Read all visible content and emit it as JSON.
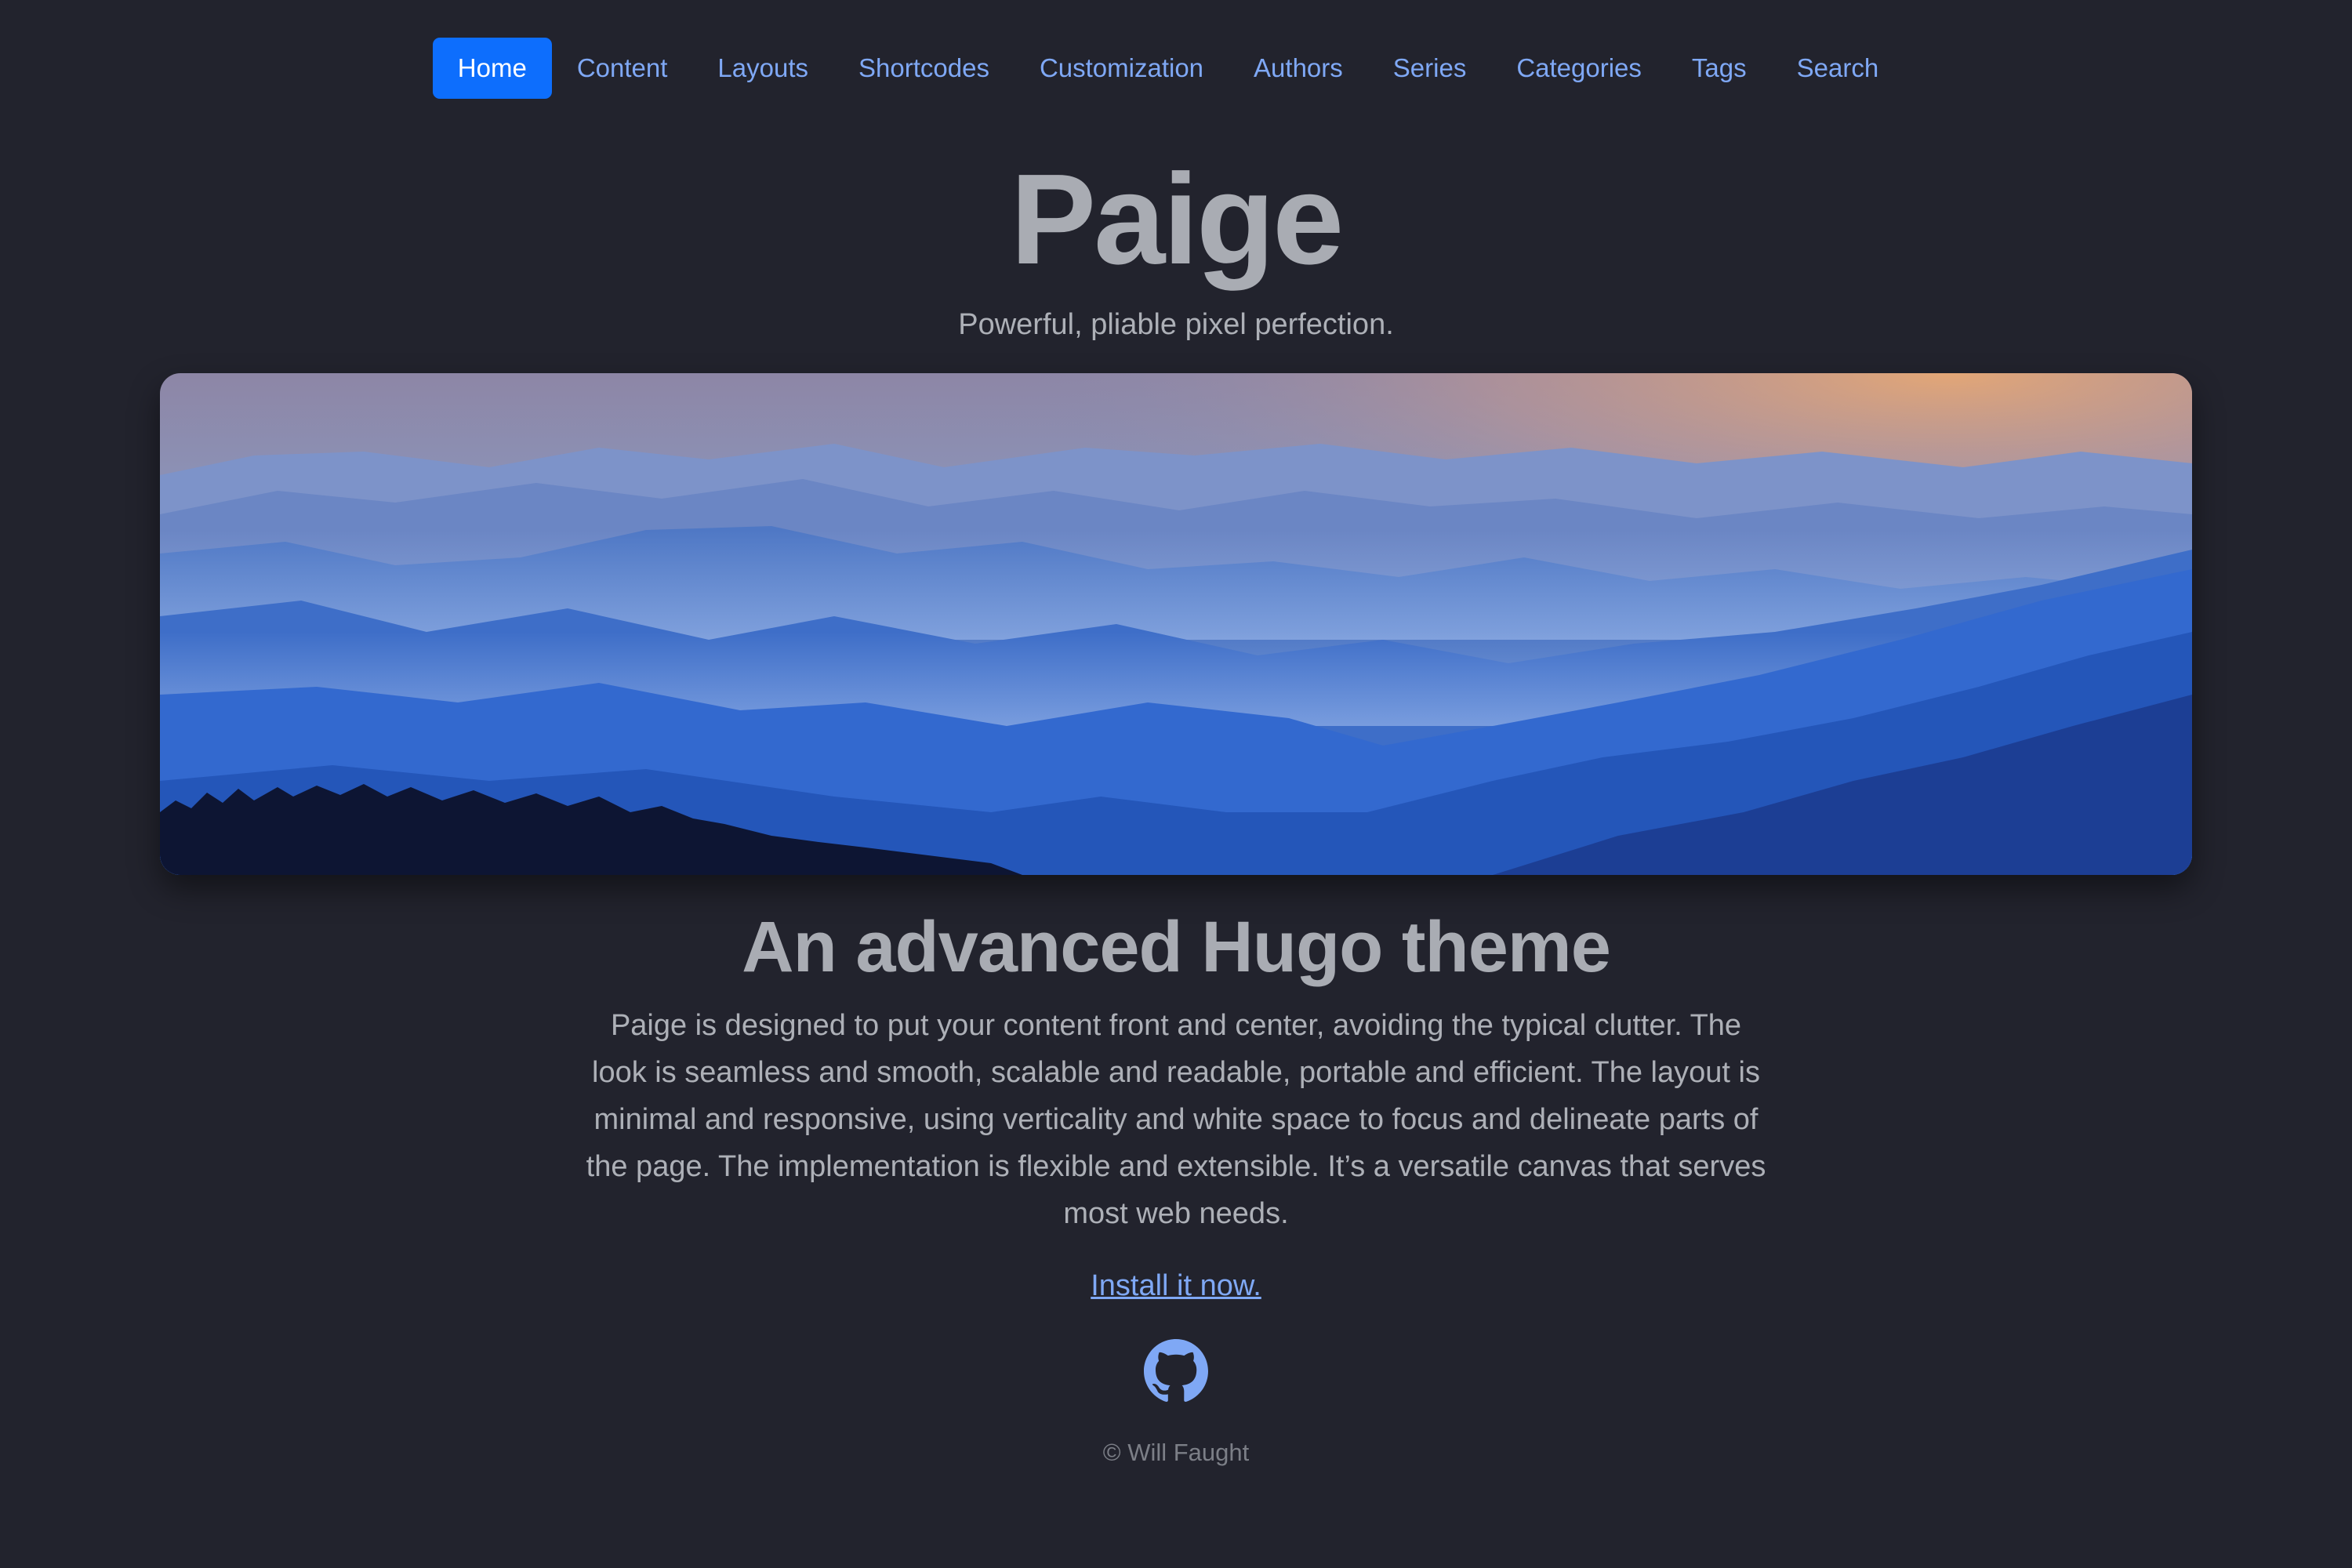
{
  "nav": {
    "items": [
      {
        "label": "Home",
        "active": true
      },
      {
        "label": "Content"
      },
      {
        "label": "Layouts"
      },
      {
        "label": "Shortcodes"
      },
      {
        "label": "Customization"
      },
      {
        "label": "Authors"
      },
      {
        "label": "Series"
      },
      {
        "label": "Categories"
      },
      {
        "label": "Tags"
      },
      {
        "label": "Search"
      }
    ]
  },
  "header": {
    "title": "Paige",
    "tagline": "Powerful, pliable pixel perfection."
  },
  "hero": {
    "image": "misty-blue-mountains-landscape"
  },
  "main": {
    "heading": "An advanced Hugo theme",
    "body": "Paige is designed to put your content front and center, avoiding the typical clutter. The look is seamless and smooth, scalable and readable, portable and efficient. The layout is minimal and responsive, using verticality and white space to focus and delineate parts of the page. The implementation is flexible and extensible. It’s a versatile canvas that serves most web needs.",
    "install_link": "Install it now."
  },
  "footer": {
    "github_icon": "github-icon",
    "copyright": "© Will Faught"
  },
  "colors": {
    "background": "#22232d",
    "accent": "#0d6efd",
    "link": "#7fa8f5",
    "text": "#adb0b7"
  }
}
